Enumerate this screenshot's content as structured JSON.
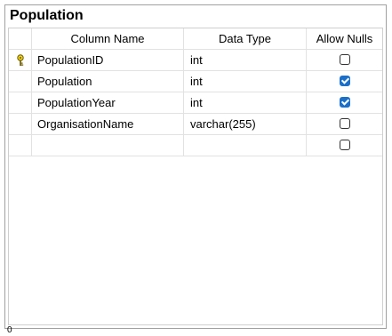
{
  "table": {
    "title": "Population",
    "headers": {
      "column_name": "Column Name",
      "data_type": "Data Type",
      "allow_nulls": "Allow Nulls"
    },
    "rows": [
      {
        "name": "PopulationID",
        "type": "int",
        "allow_nulls": false,
        "primary_key": true
      },
      {
        "name": "Population",
        "type": "int",
        "allow_nulls": true,
        "primary_key": false
      },
      {
        "name": "PopulationYear",
        "type": "int",
        "allow_nulls": true,
        "primary_key": false
      },
      {
        "name": "OrganisationName",
        "type": "varchar(255)",
        "allow_nulls": false,
        "primary_key": false
      },
      {
        "name": "",
        "type": "",
        "allow_nulls": false,
        "primary_key": false
      }
    ]
  },
  "footer": {
    "text": "0"
  },
  "colors": {
    "checkbox_checked": "#1a6fc9",
    "key_icon": "#e0c000"
  },
  "icons": {
    "primary_key": "key-icon"
  }
}
